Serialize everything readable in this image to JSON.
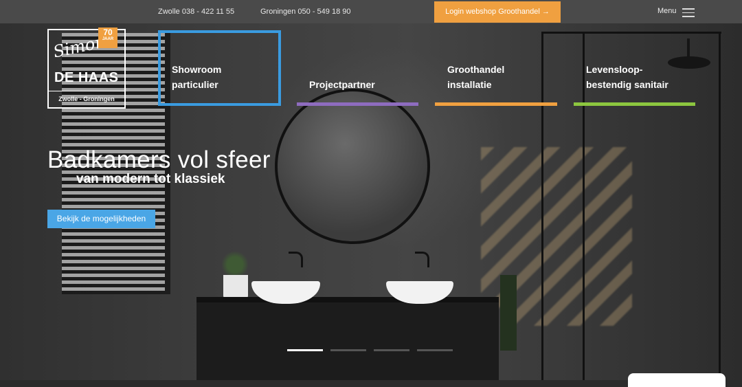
{
  "topbar": {
    "phone_zwolle": "Zwolle 038 - 422 11 55",
    "phone_groningen": "Groningen 050 - 549 18 90",
    "login_label": "Login webshop Groothandel",
    "login_arrow": "→",
    "menu_label": "Menu"
  },
  "logo": {
    "script": "Simon",
    "name": "DE HAAS",
    "sub": "Zwolle - Groningen",
    "badge_num": "70",
    "badge_txt": "JAAR"
  },
  "categories": [
    {
      "line1": "Showroom",
      "line2": "particulier",
      "color": "#3a9be0"
    },
    {
      "line1": "",
      "line2": "Projectpartner",
      "color": "#8e6cbf"
    },
    {
      "line1": "Groothandel",
      "line2": "installatie",
      "color": "#f0a040"
    },
    {
      "line1": "Levensloop-",
      "line2": "bestendig sanitair",
      "color": "#8cc63f"
    }
  ],
  "hero": {
    "headline": "Badkamers vol sfeer",
    "subhead": "van modern tot klassiek",
    "cta_label": "Bekijk de mogelijkheden"
  },
  "slider": {
    "count": 4,
    "active": 1
  },
  "colors": {
    "accent_orange": "#f0a040",
    "accent_blue": "#4aa6e6"
  }
}
